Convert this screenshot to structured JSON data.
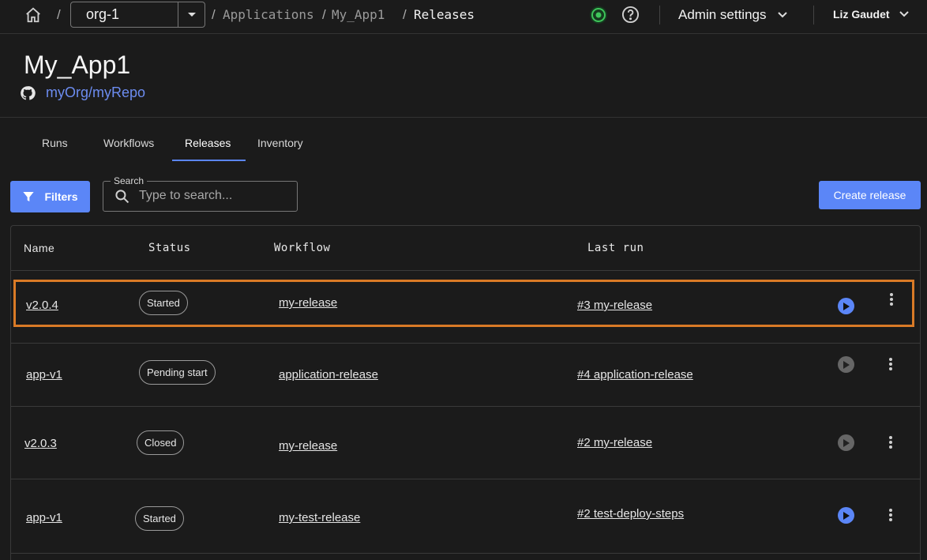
{
  "breadcrumb": {
    "org": "org-1",
    "items": [
      "Applications",
      "My_App1",
      "Releases"
    ]
  },
  "header_right": {
    "admin_label": "Admin settings",
    "user_name": "Liz Gaudet"
  },
  "app": {
    "title": "My_App1",
    "repo": "myOrg/myRepo"
  },
  "tabs": [
    {
      "label": "Runs"
    },
    {
      "label": "Workflows"
    },
    {
      "label": "Releases",
      "active": true
    },
    {
      "label": "Inventory"
    }
  ],
  "toolbar": {
    "filters_label": "Filters",
    "search_legend": "Search",
    "search_placeholder": "Type to search...",
    "create_label": "Create release"
  },
  "table": {
    "columns": [
      "Name",
      "Status",
      "Workflow",
      "Last run"
    ],
    "rows": [
      {
        "name": "v2.0.4",
        "status": "Started",
        "workflow": "my-release",
        "last_run": "#3 my-release",
        "run_enabled": true,
        "highlighted": true
      },
      {
        "name": "app-v1",
        "status": "Pending start",
        "workflow": "application-release",
        "last_run": "#4 application-release",
        "run_enabled": false
      },
      {
        "name": "v2.0.3",
        "status": "Closed",
        "workflow": "my-release",
        "last_run": "#2 my-release",
        "run_enabled": false
      },
      {
        "name": "app-v1",
        "status": "Started",
        "workflow": "my-test-release",
        "last_run": "#2 test-deploy-steps",
        "run_enabled": true
      }
    ]
  },
  "colors": {
    "accent": "#5b86f7",
    "highlight": "#d97a26",
    "status_online": "#3ec55a"
  },
  "icons": [
    "home-icon",
    "chevron-down-icon",
    "status-online-icon",
    "help-icon",
    "github-icon",
    "filter-icon",
    "search-icon",
    "play-icon",
    "more-vertical-icon"
  ]
}
